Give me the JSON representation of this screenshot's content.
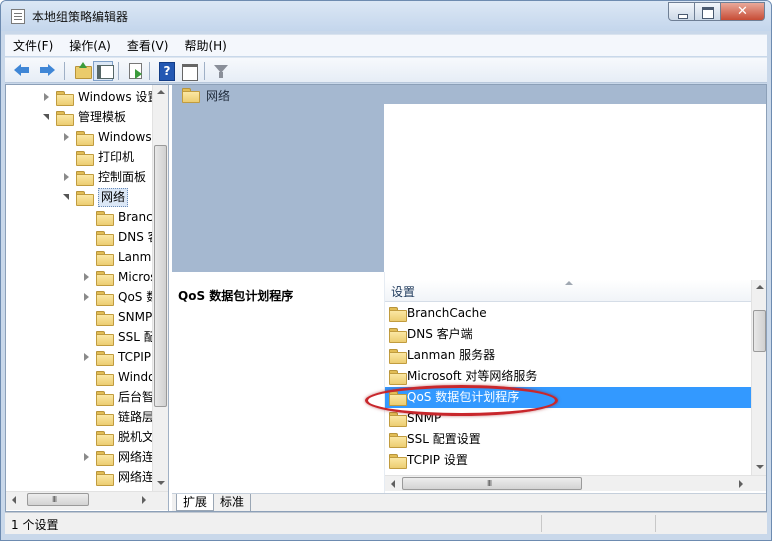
{
  "window": {
    "title": "本地组策略编辑器",
    "close_glyph": "✕"
  },
  "menu": [
    "文件(F)",
    "操作(A)",
    "查看(V)",
    "帮助(H)"
  ],
  "tree": {
    "items": [
      {
        "label": "Windows 设置",
        "expander": "closed"
      },
      {
        "label": "管理模板",
        "expander": "open"
      },
      {
        "label": "Windows 组件",
        "expander": "closed"
      },
      {
        "label": "打印机",
        "expander": "none"
      },
      {
        "label": "控制面板",
        "expander": "closed"
      },
      {
        "label": "网络",
        "expander": "open"
      },
      {
        "label": "BranchCache",
        "expander": "none"
      },
      {
        "label": "DNS 客户端",
        "expander": "none"
      },
      {
        "label": "Lanman 服务器",
        "expander": "none"
      },
      {
        "label": "Microsoft 对等网络服务",
        "expander": "closed"
      },
      {
        "label": "QoS 数据包计划程序",
        "expander": "closed"
      },
      {
        "label": "SNMP",
        "expander": "none"
      },
      {
        "label": "SSL 配置设置",
        "expander": "none"
      },
      {
        "label": "TCPIP 设置",
        "expander": "closed"
      },
      {
        "label": "Windows 即时连接",
        "expander": "none"
      },
      {
        "label": "后台智能传送服务",
        "expander": "none"
      },
      {
        "label": "链路层拓扑发现",
        "expander": "none"
      },
      {
        "label": "脱机文件",
        "expander": "none"
      },
      {
        "label": "网络连接",
        "expander": "closed"
      },
      {
        "label": "网络连接状态指示器",
        "expander": "none"
      }
    ],
    "scroll_grip": "III"
  },
  "header": {
    "title": "网络"
  },
  "description": {
    "title": "QoS 数据包计划程序"
  },
  "list": {
    "column": "设置",
    "rows": [
      "BranchCache",
      "DNS 客户端",
      "Lanman 服务器",
      "Microsoft 对等网络服务",
      "QoS 数据包计划程序",
      "SNMP",
      "SSL 配置设置",
      "TCPIP 设置"
    ],
    "selected": "QoS 数据包计划程序",
    "scroll_grip": "III"
  },
  "tabs": [
    "扩展",
    "标准"
  ],
  "status": {
    "text": "1 个设置"
  },
  "colors": {
    "selection": "#3399ff",
    "highlight_ellipse": "#c8272c",
    "header_band": "#a5b8d0"
  }
}
